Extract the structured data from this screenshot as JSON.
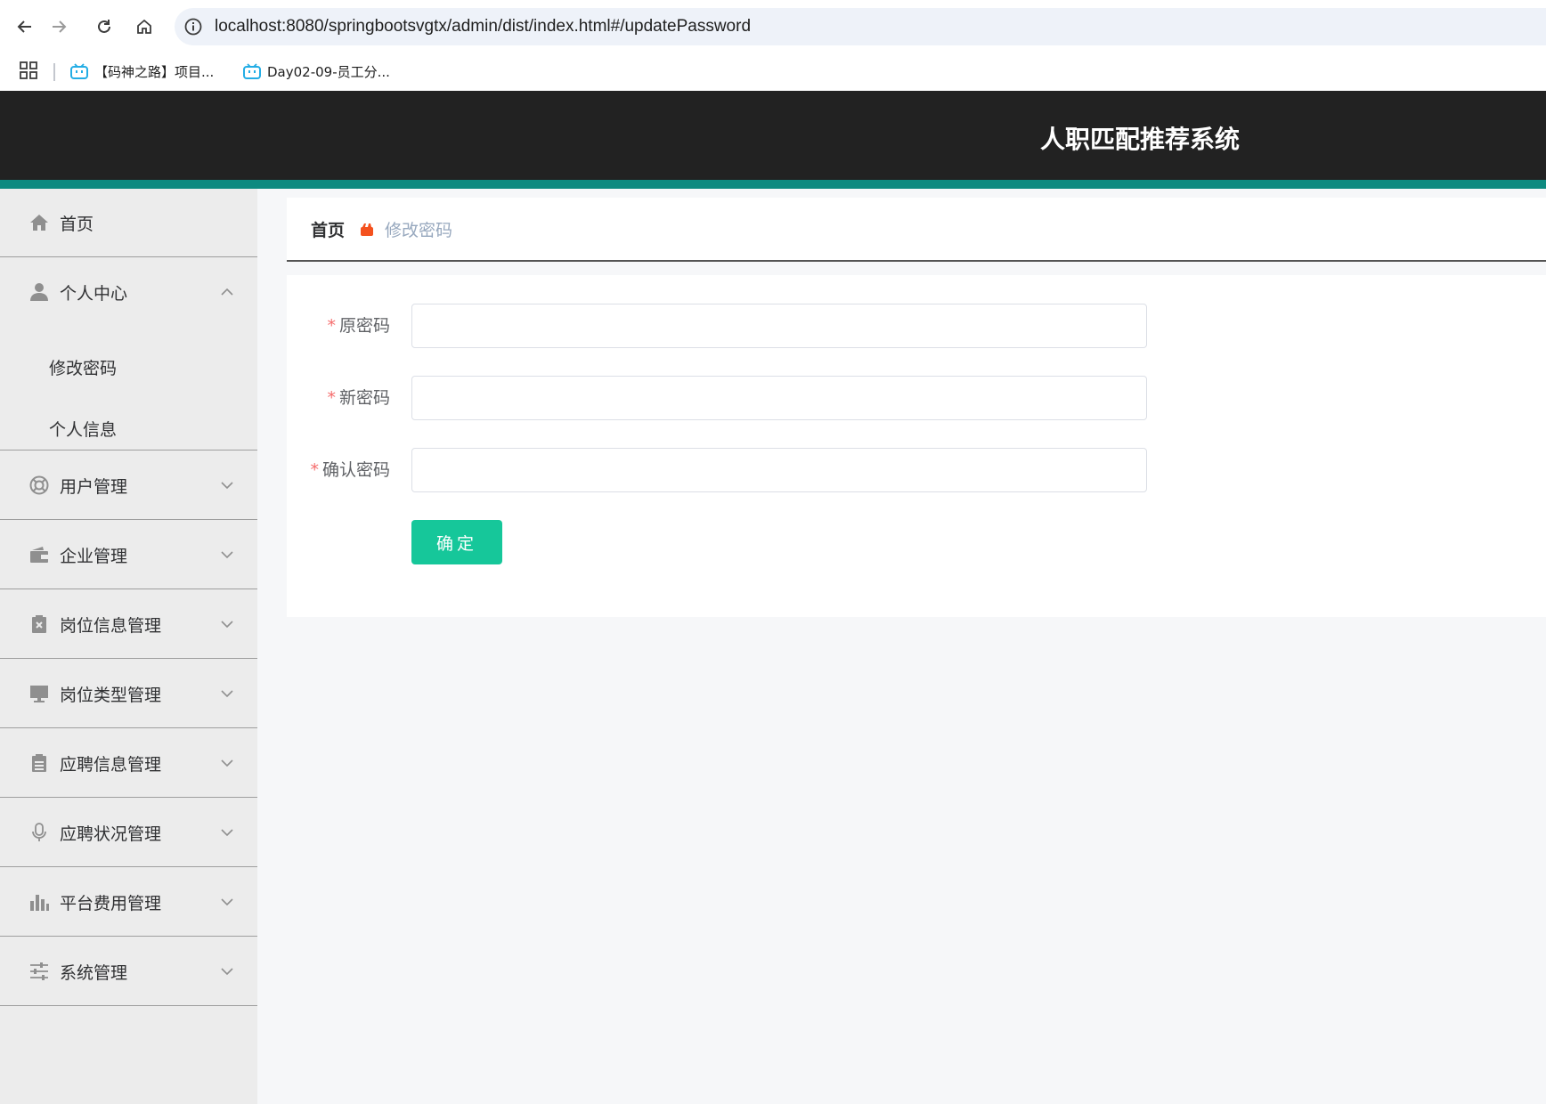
{
  "browser": {
    "url": "localhost:8080/springbootsvgtx/admin/dist/index.html#/updatePassword",
    "bookmarks": [
      {
        "label": "【码神之路】项目..."
      },
      {
        "label": "Day02-09-员工分..."
      }
    ]
  },
  "header": {
    "title": "人职匹配推荐系统"
  },
  "sidebar": {
    "items": [
      {
        "label": "首页",
        "icon": "home-icon"
      },
      {
        "label": "个人中心",
        "icon": "user-icon",
        "expanded": true,
        "children": [
          {
            "label": "修改密码"
          },
          {
            "label": "个人信息"
          }
        ]
      },
      {
        "label": "用户管理",
        "icon": "lifebuoy-icon"
      },
      {
        "label": "企业管理",
        "icon": "wallet-icon"
      },
      {
        "label": "岗位信息管理",
        "icon": "clipboard-x-icon"
      },
      {
        "label": "岗位类型管理",
        "icon": "monitor-icon"
      },
      {
        "label": "应聘信息管理",
        "icon": "clipboard-icon"
      },
      {
        "label": "应聘状况管理",
        "icon": "microphone-icon"
      },
      {
        "label": "平台费用管理",
        "icon": "bar-chart-icon"
      },
      {
        "label": "系统管理",
        "icon": "sliders-icon"
      }
    ]
  },
  "breadcrumb": {
    "home": "首页",
    "current": "修改密码"
  },
  "form": {
    "fields": [
      {
        "label": "原密码",
        "value": ""
      },
      {
        "label": "新密码",
        "value": ""
      },
      {
        "label": "确认密码",
        "value": ""
      }
    ],
    "submit_label": "确定"
  },
  "colors": {
    "header_bg": "#222222",
    "header_accent": "#0e8a80",
    "button": "#16c79a",
    "required": "#f56c6c",
    "breadcrumb_icon": "#f4511e"
  }
}
